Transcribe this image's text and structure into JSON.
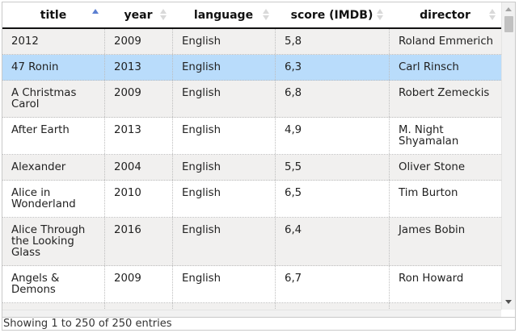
{
  "table": {
    "columns": [
      {
        "label": "title",
        "sort": "asc"
      },
      {
        "label": "year",
        "sort": "none"
      },
      {
        "label": "language",
        "sort": "none"
      },
      {
        "label": "score (IMDB)",
        "sort": "none"
      },
      {
        "label": "director",
        "sort": "none"
      }
    ],
    "rows": [
      {
        "title": "2012",
        "year": "2009",
        "language": "English",
        "score": "5,8",
        "director": "Roland Emmerich"
      },
      {
        "title": "47 Ronin",
        "year": "2013",
        "language": "English",
        "score": "6,3",
        "director": "Carl Rinsch",
        "selected": true
      },
      {
        "title": "A Christmas Carol",
        "year": "2009",
        "language": "English",
        "score": "6,8",
        "director": "Robert Zemeckis"
      },
      {
        "title": "After Earth",
        "year": "2013",
        "language": "English",
        "score": "4,9",
        "director": "M. Night Shyamalan"
      },
      {
        "title": "Alexander",
        "year": "2004",
        "language": "English",
        "score": "5,5",
        "director": "Oliver Stone"
      },
      {
        "title": "Alice in Wonderland",
        "year": "2010",
        "language": "English",
        "score": "6,5",
        "director": "Tim Burton"
      },
      {
        "title": "Alice Through the Looking Glass",
        "year": "2016",
        "language": "English",
        "score": "6,4",
        "director": "James Bobin"
      },
      {
        "title": "Angels & Demons",
        "year": "2009",
        "language": "English",
        "score": "6,7",
        "director": "Ron Howard"
      }
    ]
  },
  "footer": {
    "info": "Showing 1 to 250 of 250 entries"
  },
  "icons": {
    "sort_active": "sort-ascending-icon",
    "sort_idle": "sort-both-icon"
  },
  "colors": {
    "selected_row": "#b9dcfb",
    "odd_row": "#f1f0ef",
    "sort_active": "#5b7fd1"
  }
}
